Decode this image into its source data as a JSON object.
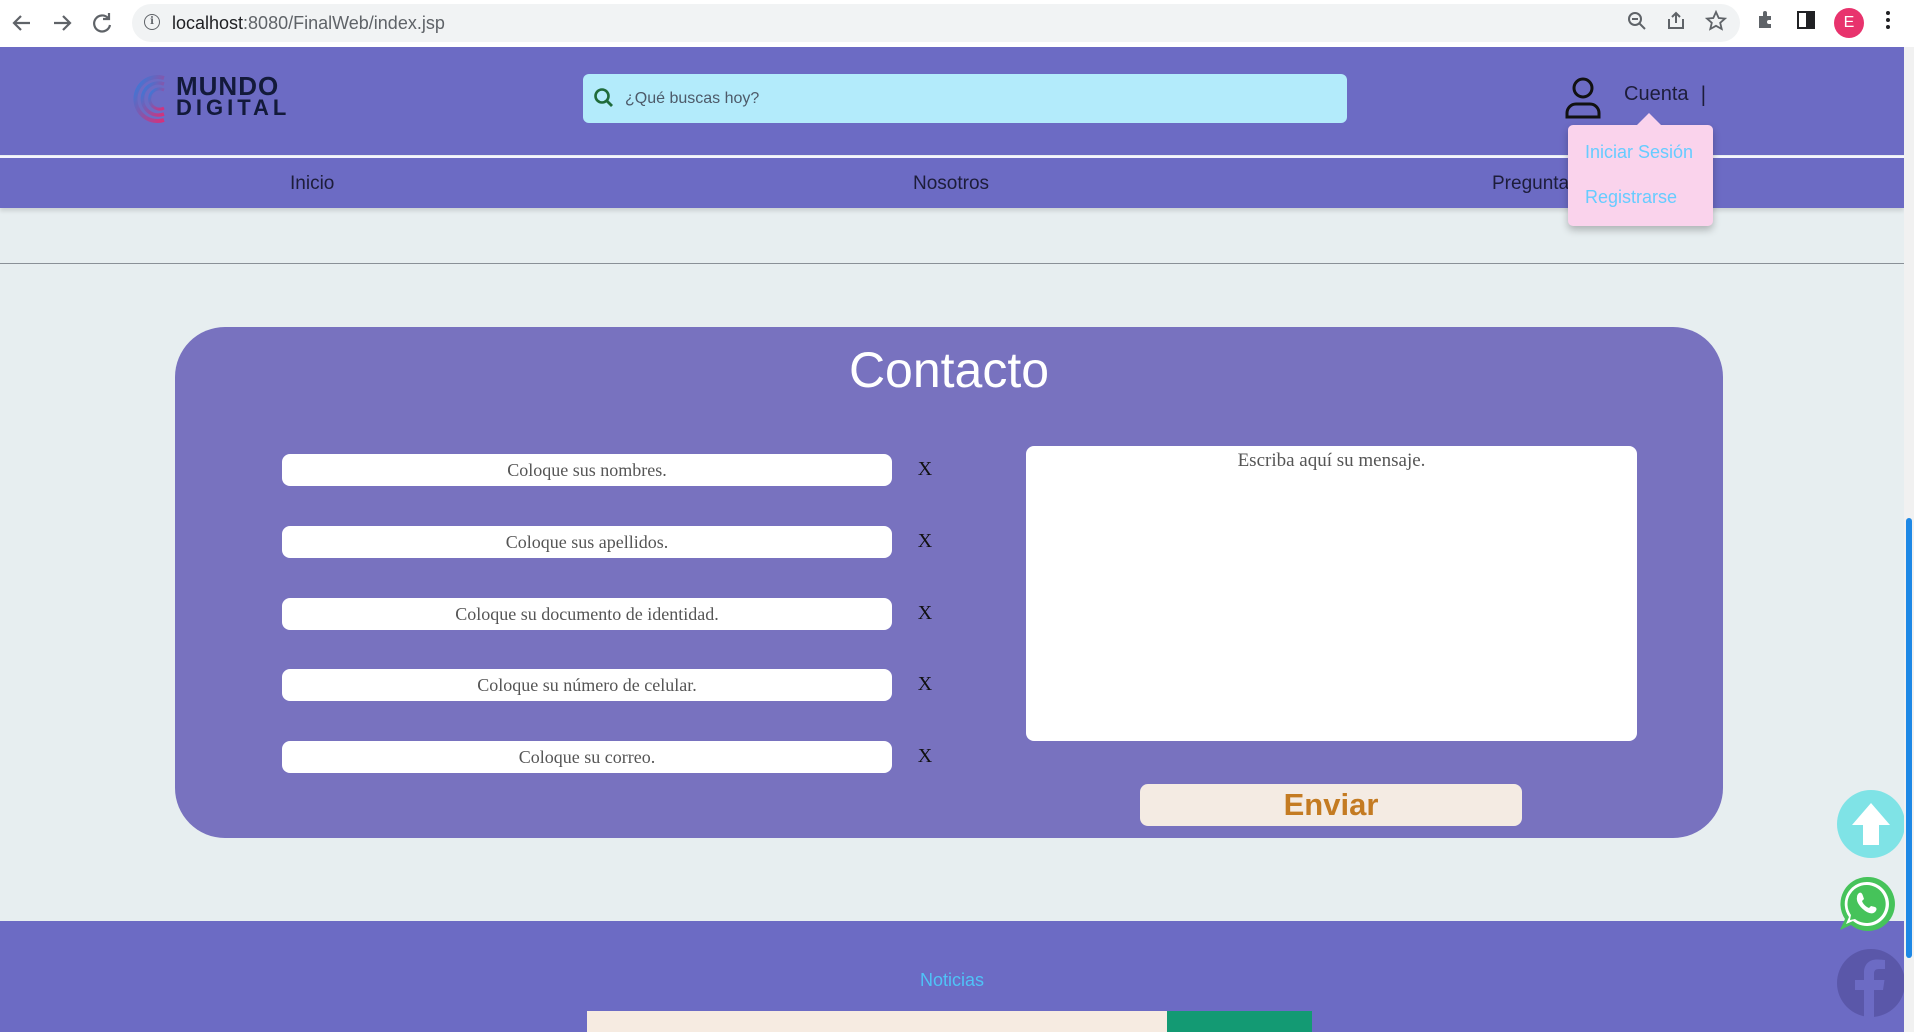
{
  "browser": {
    "url_host": "localhost",
    "url_path": ":8080/FinalWeb/index.jsp",
    "profile_initial": "E"
  },
  "header": {
    "logo_line1": "MUNDO",
    "logo_line2": "DIGITAL",
    "search_placeholder": "¿Qué buscas hoy?",
    "account_label": "Cuenta",
    "account_separator": "|"
  },
  "account_menu": {
    "items": [
      {
        "label": "Iniciar Sesión"
      },
      {
        "label": "Registrarse"
      }
    ]
  },
  "nav": {
    "items": [
      {
        "label": "Inicio"
      },
      {
        "label": "Nosotros"
      },
      {
        "label": "Pregunta"
      }
    ]
  },
  "contact": {
    "title": "Contacto",
    "fields": [
      {
        "placeholder": "Coloque sus nombres.",
        "clear": "X"
      },
      {
        "placeholder": "Coloque sus apellidos.",
        "clear": "X"
      },
      {
        "placeholder": "Coloque su documento de identidad.",
        "clear": "X"
      },
      {
        "placeholder": "Coloque su número de celular.",
        "clear": "X"
      },
      {
        "placeholder": "Coloque su correo.",
        "clear": "X"
      }
    ],
    "message_placeholder": "Escriba aquí su mensaje.",
    "send_label": "Enviar"
  },
  "footer": {
    "news_label": "Noticias"
  },
  "colors": {
    "header_bg": "#6c6bc4",
    "card_bg": "#7872bf",
    "search_bg": "#b3ebfb",
    "dropdown_bg": "#fad3ec",
    "dropdown_text": "#66ccff",
    "send_text": "#c47b22",
    "page_bg": "#e7eef0"
  },
  "icons": {
    "back": "arrow-left-icon",
    "forward": "arrow-right-icon",
    "reload": "reload-icon",
    "search": "search-icon",
    "account": "user-icon",
    "scroll_top": "arrow-up-icon",
    "whatsapp": "whatsapp-icon",
    "facebook": "facebook-icon"
  }
}
